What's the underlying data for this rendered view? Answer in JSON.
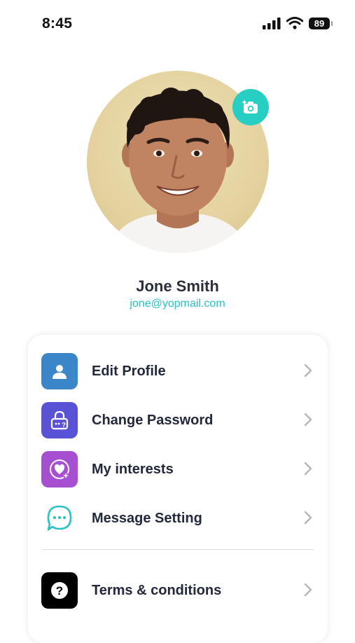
{
  "status_bar": {
    "time": "8:45",
    "battery": "89"
  },
  "profile": {
    "name": "Jone Smith",
    "email": "jone@yopmail.com"
  },
  "menu": {
    "items": [
      {
        "label": "Edit Profile",
        "icon": "person-icon",
        "color": "#3a86c9"
      },
      {
        "label": "Change Password",
        "icon": "lock-icon",
        "color": "#5a52d6"
      },
      {
        "label": "My interests",
        "icon": "heart-icon",
        "color": "#a64fd0"
      },
      {
        "label": "Message Setting",
        "icon": "chat-bubble-icon",
        "color": "#27c2c4"
      },
      {
        "label": "Terms & conditions",
        "icon": "question-icon",
        "color": "#000000"
      }
    ]
  },
  "colors": {
    "accent": "#27cfc3",
    "email": "#27c2c4"
  }
}
